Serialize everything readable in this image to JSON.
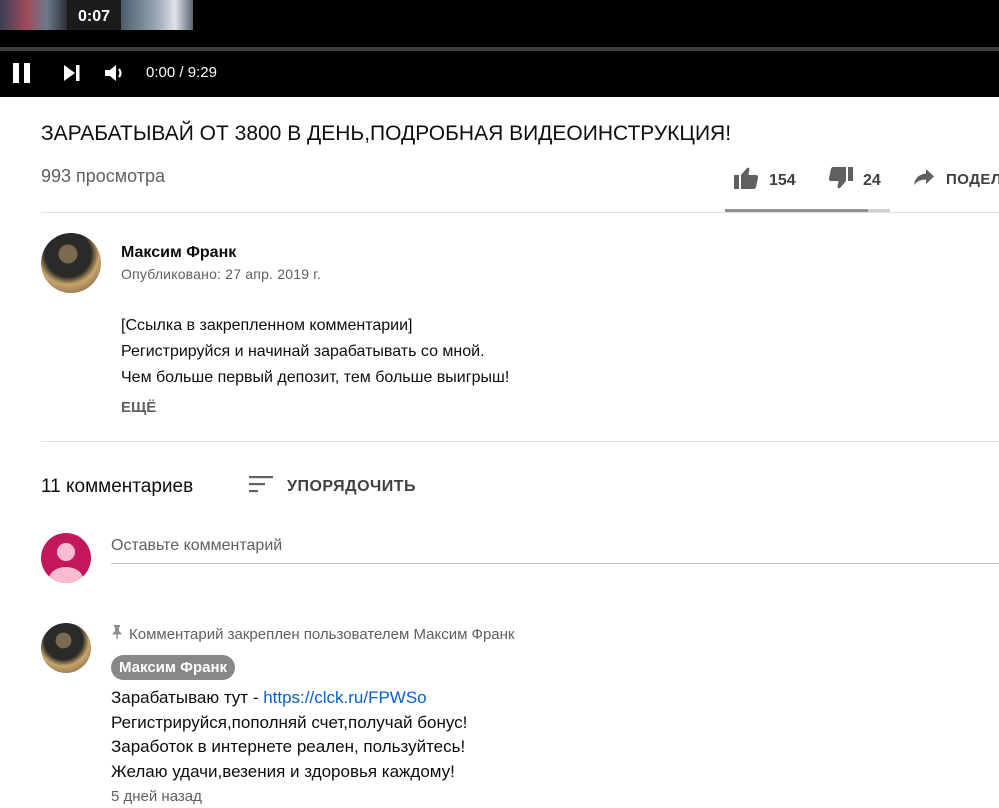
{
  "player": {
    "preview_time": "0:07",
    "current_time": "0:00",
    "duration": "9:29",
    "progress_fraction": 0.0,
    "pause_icon": "pause-icon",
    "next_icon": "next-icon",
    "volume_icon": "volume-icon"
  },
  "video": {
    "title": "ЗАРАБАТЫВАЙ ОТ 3800 В ДЕНЬ,ПОДРОБНАЯ ВИДЕОИНСТРУКЦИЯ!",
    "views": "993 просмотра",
    "likes": "154",
    "dislikes": "24",
    "share_label": "ПОДЕЛ",
    "like_ratio": 0.865
  },
  "channel": {
    "name": "Максим Франк",
    "published": "Опубликовано: 27 апр. 2019 г."
  },
  "description": {
    "lines": [
      "[Ссылка в закрепленном комментарии]",
      "Регистрируйся и начинай зарабатывать со мной.",
      "Чем больше первый депозит, тем больше выигрыш!"
    ],
    "more_label": "ЕЩЁ"
  },
  "comments": {
    "count_label": "11 комментариев",
    "sort_label": "УПОРЯДОЧИТЬ",
    "input_placeholder": "Оставьте комментарий",
    "pinned": {
      "pinned_label": "Комментарий закреплен пользователем Максим Франк",
      "author": "Максим Франк",
      "line1_prefix": "Зарабатываю тут - ",
      "link": "https://clck.ru/FPWSo",
      "lines": [
        "Регистрируйся,пополняй счет,получай бонус!",
        "Заработок в интернете реален, пользуйтесь!",
        "Желаю удачи,везения и здоровья каждому!"
      ],
      "time": "5 дней назад"
    }
  },
  "colors": {
    "link": "#065fd4",
    "avatar_user": "#c2185b",
    "badge": "#888888"
  }
}
